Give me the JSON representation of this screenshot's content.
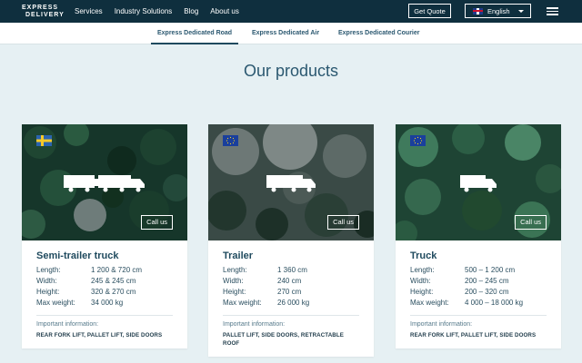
{
  "header": {
    "logo_line1": "EXPRESS",
    "logo_line2": "DELIVERY",
    "nav": [
      "Services",
      "Industry Solutions",
      "Blog",
      "About us"
    ],
    "quote_label": "Get Quote",
    "language": "English"
  },
  "subnav": {
    "tabs": [
      "Express Dedicated Road",
      "Express Dedicated Air",
      "Express Dedicated Courier"
    ],
    "active_tab": "Express Dedicated Road"
  },
  "page_title": "Our products",
  "products": [
    {
      "flag": "sweden-flag-icon",
      "name": "Semi-trailer truck",
      "call_label": "Call us",
      "specs": [
        {
          "label": "Length:",
          "value": "1 200 & 720 cm"
        },
        {
          "label": "Width:",
          "value": "245 & 245 cm"
        },
        {
          "label": "Height:",
          "value": "320 & 270 cm"
        },
        {
          "label": "Max weight:",
          "value": "34 000 kg"
        }
      ],
      "info_label": "Important information:",
      "info_value": "REAR FORK LIFT, PALLET LIFT, SIDE DOORS"
    },
    {
      "flag": "eu-flag-icon",
      "name": "Trailer",
      "call_label": "Call us",
      "specs": [
        {
          "label": "Length:",
          "value": "1 360 cm"
        },
        {
          "label": "Width:",
          "value": "240 cm"
        },
        {
          "label": "Height:",
          "value": "270 cm"
        },
        {
          "label": "Max weight:",
          "value": "26 000 kg"
        }
      ],
      "info_label": "Important information:",
      "info_value": "PALLET LIFT, SIDE DOORS, RETRACTABLE ROOF"
    },
    {
      "flag": "eu-flag-icon",
      "name": "Truck",
      "call_label": "Call us",
      "specs": [
        {
          "label": "Length:",
          "value": "500 – 1 200 cm"
        },
        {
          "label": "Width:",
          "value": "200 – 245 cm"
        },
        {
          "label": "Height:",
          "value": "200 – 320 cm"
        },
        {
          "label": "Max weight:",
          "value": "4 000 – 18 000 kg"
        }
      ],
      "info_label": "Important information:",
      "info_value": "REAR FORK LIFT, PALLET LIFT, SIDE DOORS"
    }
  ],
  "colors": {
    "header_bg": "#0f2f3e",
    "accent": "#1f4a5e",
    "page_bg": "#e6f0f3"
  }
}
